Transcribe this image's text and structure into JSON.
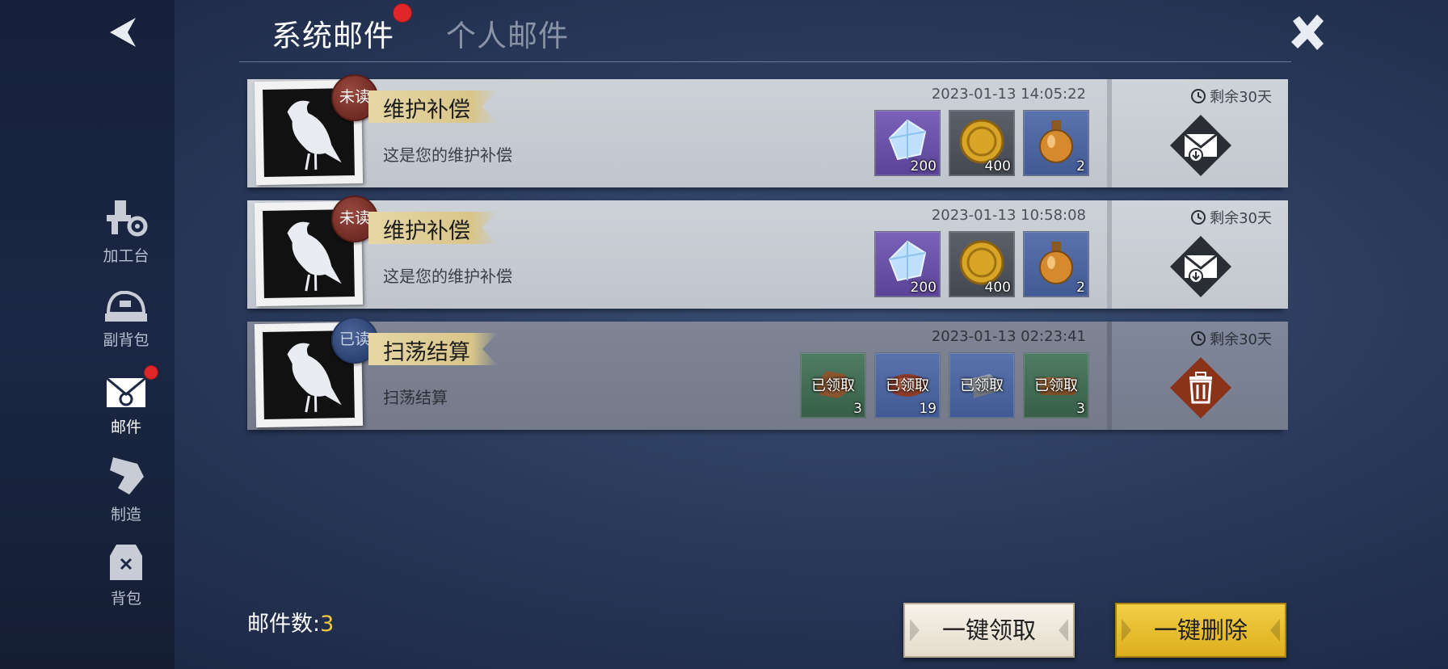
{
  "tabs": {
    "system": "系统邮件",
    "personal": "个人邮件"
  },
  "sidebar": {
    "items": [
      {
        "label": "加工台",
        "icon": "workbench-icon"
      },
      {
        "label": "副背包",
        "icon": "sub-bag-icon"
      },
      {
        "label": "邮件",
        "icon": "mail-icon"
      },
      {
        "label": "制造",
        "icon": "craft-icon"
      },
      {
        "label": "背包",
        "icon": "backpack-icon"
      }
    ]
  },
  "mails": [
    {
      "status": "未读",
      "title": "维护补偿",
      "subtitle": "这是您的维护补偿",
      "time": "2023-01-13 14:05:22",
      "remaining": "剩余30天",
      "rewards": [
        {
          "icon": "crystal-icon",
          "qty": "200"
        },
        {
          "icon": "gold-coin-icon",
          "qty": "400"
        },
        {
          "icon": "potion-icon",
          "qty": "2"
        }
      ]
    },
    {
      "status": "未读",
      "title": "维护补偿",
      "subtitle": "这是您的维护补偿",
      "time": "2023-01-13 10:58:08",
      "remaining": "剩余30天",
      "rewards": [
        {
          "icon": "crystal-icon",
          "qty": "200"
        },
        {
          "icon": "gold-coin-icon",
          "qty": "400"
        },
        {
          "icon": "potion-icon",
          "qty": "2"
        }
      ]
    },
    {
      "status": "已读",
      "title": "扫荡结算",
      "subtitle": "扫荡结算",
      "time": "2023-01-13 02:23:41",
      "remaining": "剩余30天",
      "rewards": [
        {
          "icon": "leather-icon",
          "qty": "3",
          "claimed": "已领取"
        },
        {
          "icon": "meat-icon",
          "qty": "19",
          "claimed": "已领取"
        },
        {
          "icon": "iron-icon",
          "qty": "",
          "claimed": "已领取"
        },
        {
          "icon": "wood-icon",
          "qty": "3",
          "claimed": "已领取"
        }
      ]
    }
  ],
  "footer": {
    "count_label": "邮件数:",
    "count": "3",
    "claim_all": "一键领取",
    "delete_all": "一键删除"
  },
  "colors": {
    "accent_gold": "#f3c944",
    "notify_red": "#e0262b"
  }
}
